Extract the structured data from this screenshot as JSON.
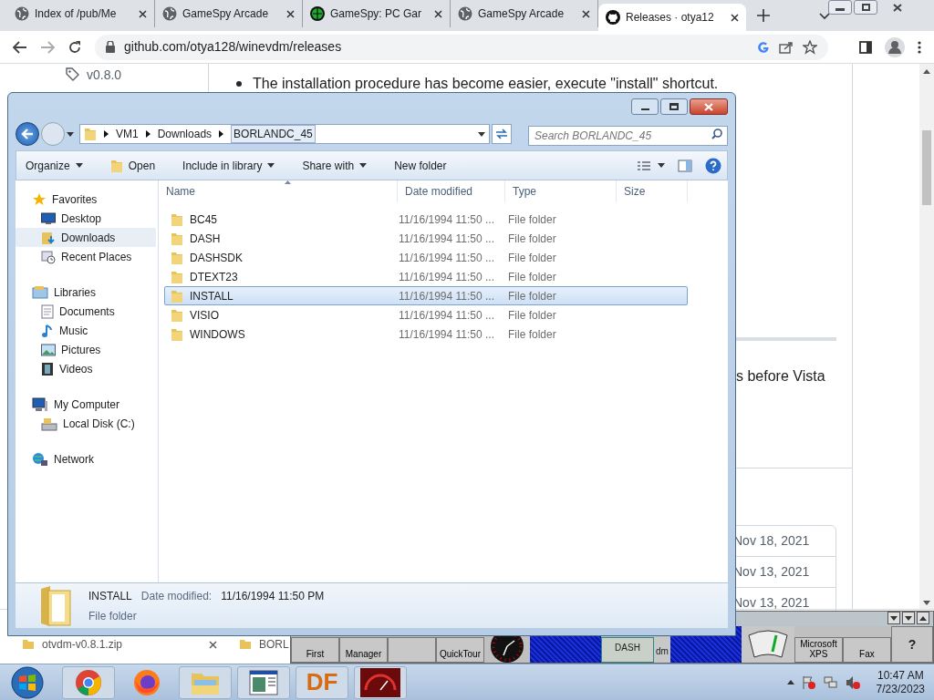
{
  "browser": {
    "tabs": [
      {
        "title": "Index of /pub/Me",
        "kind": "globe",
        "selected": false
      },
      {
        "title": "GameSpy Arcade",
        "kind": "globe",
        "selected": false
      },
      {
        "title": "GameSpy: PC Gar",
        "kind": "gamespy",
        "selected": false
      },
      {
        "title": "GameSpy Arcade",
        "kind": "globe",
        "selected": false
      },
      {
        "title": "Releases · otya12",
        "kind": "github",
        "selected": true
      }
    ],
    "url": "github.com/otya128/winevdm/releases"
  },
  "page": {
    "tag": "v0.8.0",
    "bullet": "The installation procedure has become easier, execute \"install\" shortcut.",
    "fragment": "s before Vista",
    "dates": [
      "Nov 18, 2021",
      "Nov 13, 2021",
      "Nov 13, 2021"
    ]
  },
  "explorer": {
    "path": [
      "VM1",
      "Downloads",
      "BORLANDC_45"
    ],
    "search_placeholder": "Search BORLANDC_45",
    "toolbar": [
      {
        "label": "Organize",
        "kind": "menu"
      },
      {
        "label": "Open",
        "kind": "open"
      },
      {
        "label": "Include in library",
        "kind": "menu"
      },
      {
        "label": "Share with",
        "kind": "menu"
      },
      {
        "label": "New folder",
        "kind": "plain"
      }
    ],
    "nav": [
      {
        "label": "Favorites",
        "kind": "star",
        "children": [
          {
            "label": "Desktop",
            "kind": "desktop",
            "selected": false
          },
          {
            "label": "Downloads",
            "kind": "downloads",
            "selected": true
          },
          {
            "label": "Recent Places",
            "kind": "recent",
            "selected": false
          }
        ]
      },
      {
        "label": "Libraries",
        "kind": "library",
        "children": [
          {
            "label": "Documents",
            "kind": "document",
            "selected": false
          },
          {
            "label": "Music",
            "kind": "music",
            "selected": false
          },
          {
            "label": "Pictures",
            "kind": "pictures",
            "selected": false
          },
          {
            "label": "Videos",
            "kind": "videos",
            "selected": false
          }
        ]
      },
      {
        "label": "My Computer",
        "kind": "computer",
        "children": [
          {
            "label": "Local Disk (C:)",
            "kind": "disk",
            "selected": false
          }
        ]
      },
      {
        "label": "Network",
        "kind": "network"
      }
    ],
    "columns": [
      "Name",
      "Date modified",
      "Type",
      "Size"
    ],
    "rows": [
      {
        "name": "BC45",
        "date": "11/16/1994 11:50 ...",
        "type": "File folder",
        "selected": false
      },
      {
        "name": "DASH",
        "date": "11/16/1994 11:50 ...",
        "type": "File folder",
        "selected": false
      },
      {
        "name": "DASHSDK",
        "date": "11/16/1994 11:50 ...",
        "type": "File folder",
        "selected": false
      },
      {
        "name": "DTEXT23",
        "date": "11/16/1994 11:50 ...",
        "type": "File folder",
        "selected": false
      },
      {
        "name": "INSTALL",
        "date": "11/16/1994 11:50 ...",
        "type": "File folder",
        "selected": true
      },
      {
        "name": "VISIO",
        "date": "11/16/1994 11:50 ...",
        "type": "File folder",
        "selected": false
      },
      {
        "name": "WINDOWS",
        "date": "11/16/1994 11:50 ...",
        "type": "File folder",
        "selected": false
      }
    ],
    "details": {
      "name": "INSTALL",
      "date_label": "Date modified:",
      "date": "11/16/1994 11:50 PM",
      "type": "File folder"
    }
  },
  "downloads": [
    {
      "name": "otvdm-v0.8.1.zip"
    },
    {
      "name": "BORL"
    }
  ],
  "dash": {
    "items": [
      {
        "kind": "button",
        "label": "First"
      },
      {
        "kind": "button",
        "label": "Manager"
      },
      {
        "kind": "blank"
      },
      {
        "kind": "button",
        "label": "QuickTour"
      },
      {
        "kind": "clock"
      },
      {
        "kind": "dither"
      },
      {
        "kind": "panel",
        "label": "DASH"
      },
      {
        "kind": "text",
        "label": "dm"
      },
      {
        "kind": "dither"
      },
      {
        "kind": "gauge"
      },
      {
        "kind": "button",
        "label": "Microsoft XPS"
      },
      {
        "kind": "button",
        "label": "Fax"
      },
      {
        "kind": "help",
        "label": "?"
      }
    ]
  },
  "taskbar": {
    "apps": [
      {
        "kind": "chrome"
      },
      {
        "kind": "firefox"
      },
      {
        "kind": "explorer"
      },
      {
        "kind": "window"
      },
      {
        "kind": "text",
        "label": "DF"
      },
      {
        "kind": "game"
      }
    ],
    "time": "10:47 AM",
    "date": "7/23/2023"
  }
}
